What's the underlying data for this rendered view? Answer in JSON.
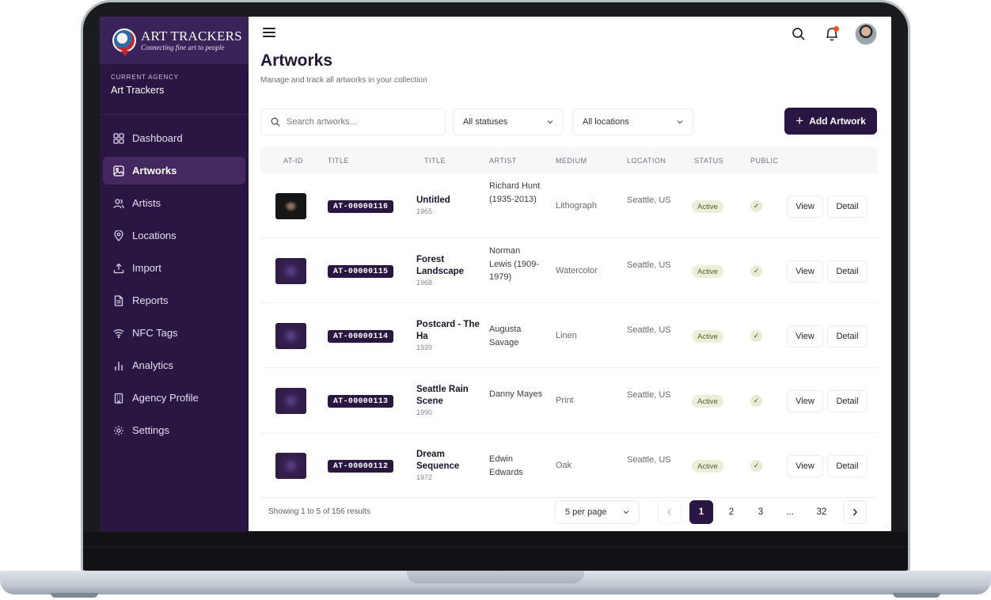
{
  "brand": {
    "name": "ART TRACKERS",
    "tagline": "Connecting fine art to people"
  },
  "agency": {
    "label": "CURRENT AGENCY",
    "name": "Art Trackers"
  },
  "nav": [
    {
      "label": "Dashboard",
      "icon": "grid-icon"
    },
    {
      "label": "Artworks",
      "icon": "image-icon",
      "active": true
    },
    {
      "label": "Artists",
      "icon": "users-icon"
    },
    {
      "label": "Locations",
      "icon": "map-pin-icon"
    },
    {
      "label": "Import",
      "icon": "upload-icon"
    },
    {
      "label": "Reports",
      "icon": "document-icon"
    },
    {
      "label": "NFC Tags",
      "icon": "wifi-icon"
    },
    {
      "label": "Analytics",
      "icon": "bar-chart-icon"
    },
    {
      "label": "Agency Profile",
      "icon": "building-icon"
    },
    {
      "label": "Settings",
      "icon": "gear-icon"
    }
  ],
  "page": {
    "title": "Artworks",
    "subtitle": "Manage and track all artworks in your collection"
  },
  "filters": {
    "search_placeholder": "Search artworks...",
    "status": "All statuses",
    "location": "All locations",
    "add_label": "Add Artwork"
  },
  "table": {
    "headers": [
      "AT-ID",
      "TITLE",
      "TITLE",
      "ARTIST",
      "MEDIUM",
      "LOCATION",
      "STATUS",
      "PUBLIC"
    ],
    "view_label": "View",
    "detail_label": "Detail",
    "rows": [
      {
        "id": "AT-00000116",
        "title": "Untitled",
        "year": "1965",
        "artist": "Richard Hunt (1935-2013)",
        "medium": "Lithograph",
        "location": "Seattle, US",
        "status": "Active",
        "public": "✓"
      },
      {
        "id": "AT-00000115",
        "title": "Forest Landscape",
        "year": "1968",
        "artist": "Norman Lewis (1909-1979)",
        "medium": "Watercolor",
        "location": "Seattle, US",
        "status": "Active",
        "public": "✓"
      },
      {
        "id": "AT-00000114",
        "title": "Postcard - The Ha",
        "year": "1939",
        "artist": "Augusta Savage",
        "medium": "Linen",
        "location": "Seattle, US",
        "status": "Active",
        "public": "✓"
      },
      {
        "id": "AT-00000113",
        "title": "Seattle Rain Scene",
        "year": "1990",
        "artist": "Danny Mayes",
        "medium": "Print",
        "location": "Seattle, US",
        "status": "Active",
        "public": "✓"
      },
      {
        "id": "AT-00000112",
        "title": "Dream Sequence",
        "year": "1972",
        "artist": "Edwin Edwards",
        "medium": "Oak",
        "location": "Seattle, US",
        "status": "Active",
        "public": "✓"
      }
    ]
  },
  "footer": {
    "showing": "Showing 1 to 5 of 156 results",
    "per_page": "5 per page",
    "pages": [
      "1",
      "2",
      "3",
      "...",
      "32"
    ]
  }
}
